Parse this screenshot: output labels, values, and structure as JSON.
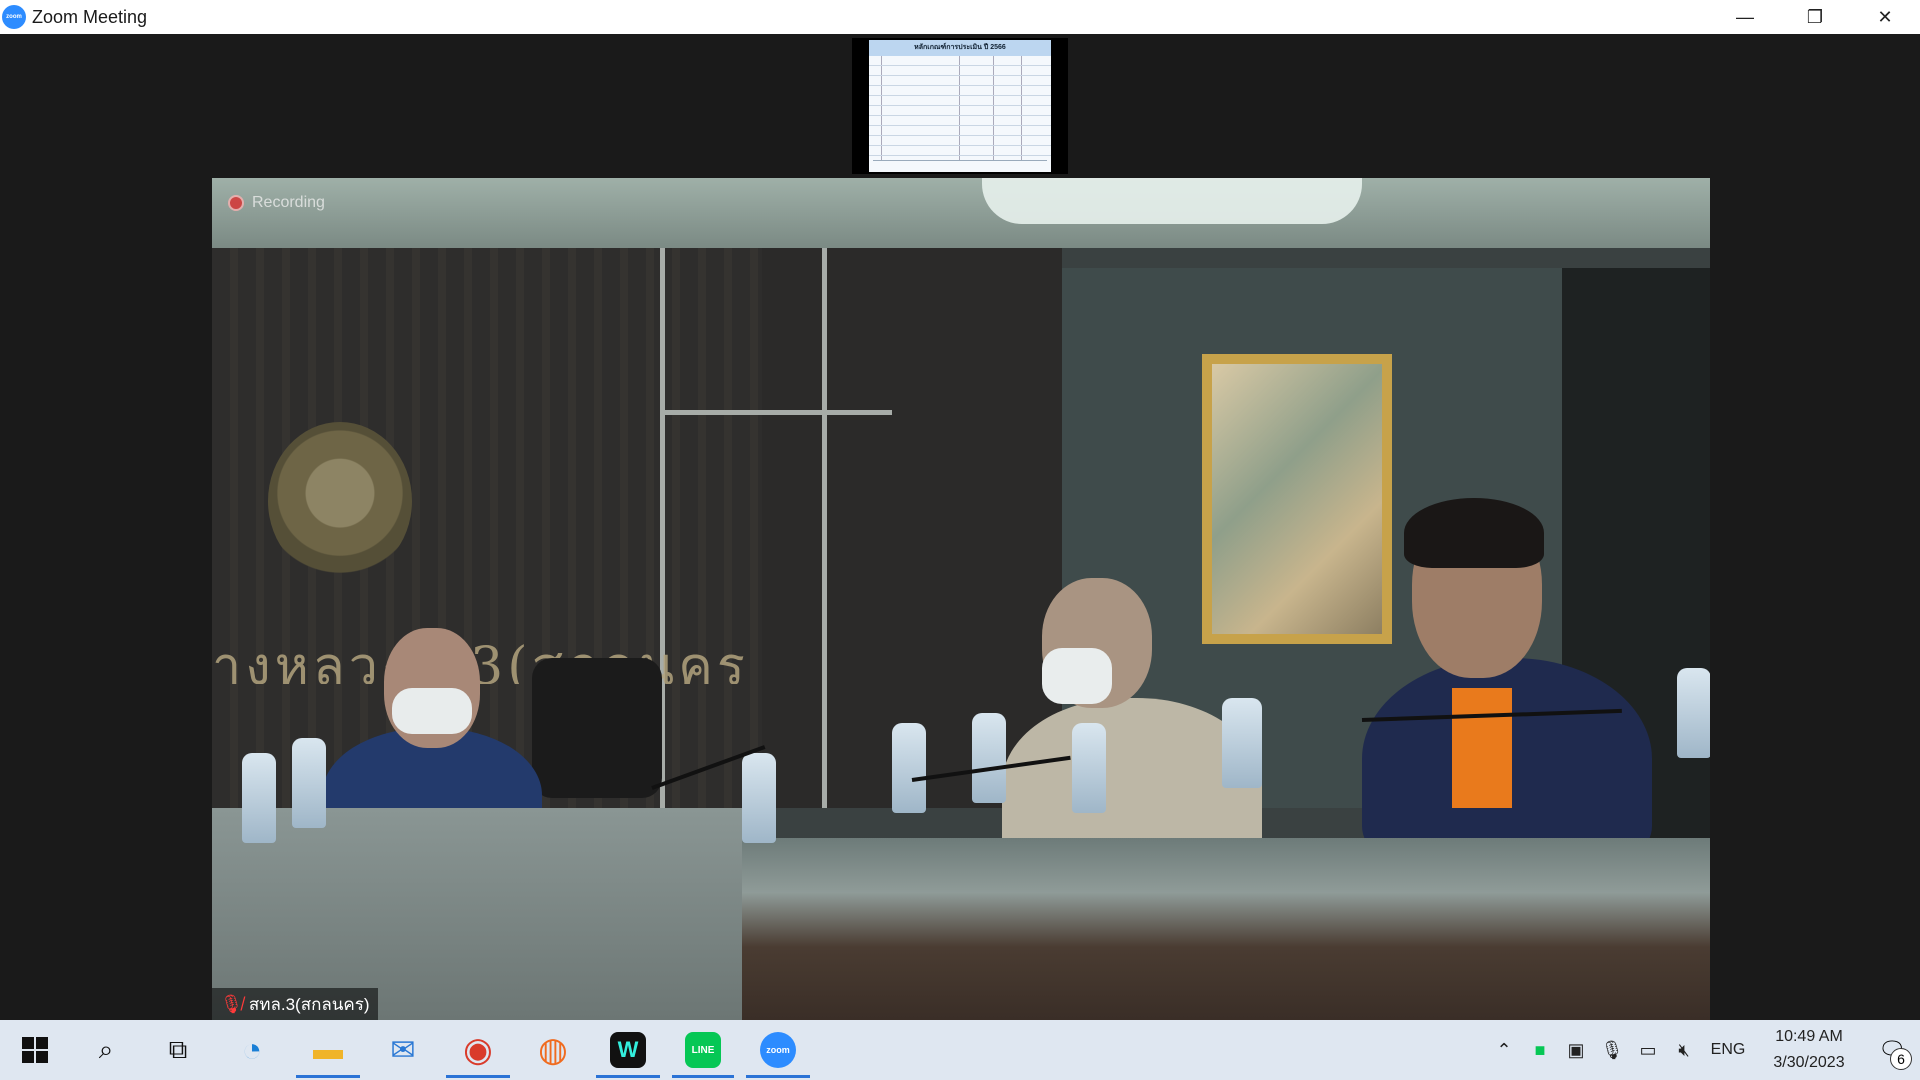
{
  "window": {
    "title": "Zoom Meeting",
    "app_icon": "zoom-logo",
    "controls": {
      "minimize": "—",
      "restore": "❐",
      "close": "✕"
    }
  },
  "share": {
    "doc_title": "หลักเกณฑ์การประเมิน ปี 2566"
  },
  "video": {
    "recording_label": "Recording",
    "participant_name": "สทล.3(สกลนคร)",
    "wall_text": "างหลวงที่ 3(สกลนคร)"
  },
  "taskbar": {
    "apps": [
      {
        "name": "start",
        "icon": "windows-logo"
      },
      {
        "name": "search",
        "icon": "search-icon",
        "glyph": "⌕"
      },
      {
        "name": "task-view",
        "icon": "task-view-icon",
        "glyph": "⧉"
      },
      {
        "name": "edge",
        "icon": "edge-icon",
        "glyph": "◔"
      },
      {
        "name": "file-explorer",
        "icon": "folder-icon",
        "glyph": "▬"
      },
      {
        "name": "mail",
        "icon": "mail-icon",
        "glyph": "✉"
      },
      {
        "name": "chrome",
        "icon": "chrome-icon",
        "glyph": "◉"
      },
      {
        "name": "firefox",
        "icon": "firefox-icon",
        "glyph": "◍"
      },
      {
        "name": "webex",
        "icon": "webex-icon",
        "glyph": "W"
      },
      {
        "name": "line",
        "icon": "line-icon",
        "glyph": "LINE"
      },
      {
        "name": "zoom",
        "icon": "zoom-icon",
        "glyph": "zoom"
      }
    ],
    "tray": {
      "language": "ENG",
      "time": "10:49 AM",
      "date": "3/30/2023",
      "notification_count": "6"
    }
  }
}
